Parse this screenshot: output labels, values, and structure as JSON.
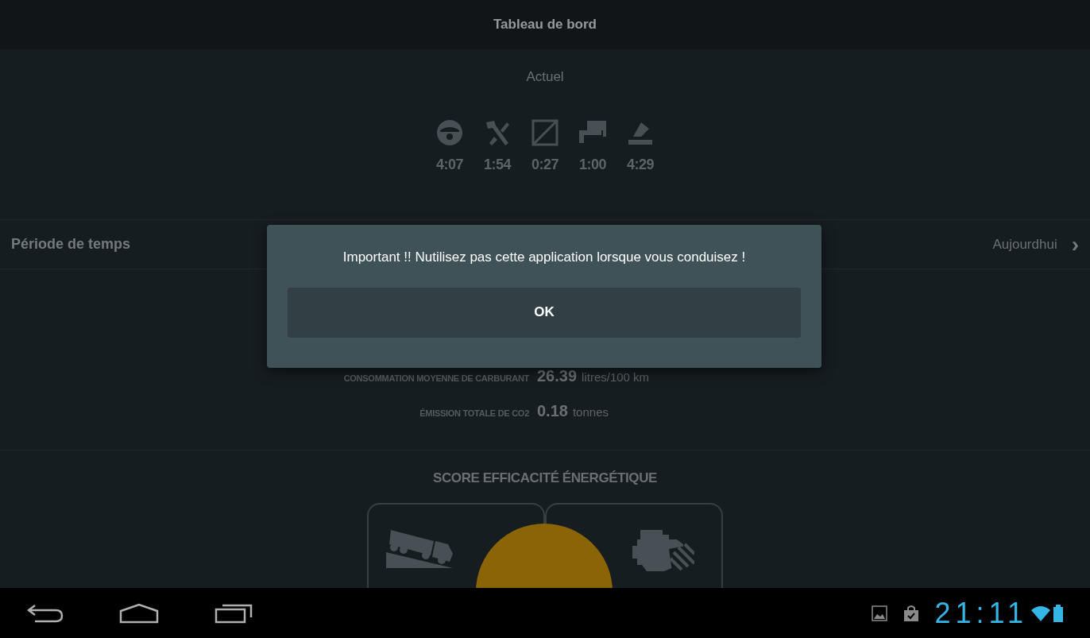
{
  "header": {
    "title": "Tableau de bord"
  },
  "current": {
    "title": "Actuel",
    "activities": [
      {
        "kind": "driving",
        "time": "4:07"
      },
      {
        "kind": "work",
        "time": "1:54"
      },
      {
        "kind": "availability",
        "time": "0:27"
      },
      {
        "kind": "rest",
        "time": "1:00"
      },
      {
        "kind": "other",
        "time": "4:29"
      }
    ]
  },
  "period": {
    "label": "Période de temps",
    "value": "Aujourdhui",
    "chevron": "›"
  },
  "stats": [
    {
      "label": "CONSOMMATION MOYENNE DE CARBURANT",
      "value": "26.39",
      "unit": "litres/100 km"
    },
    {
      "label": "ÉMISSION TOTALE DE CO2",
      "value": "0.18",
      "unit": "tonnes"
    }
  ],
  "score": {
    "title": "SCORE EFFICACITÉ ÉNERGÉTIQUE"
  },
  "dialog": {
    "message": "Important !! Nutilisez pas cette application lorsque vous conduisez !",
    "button": "OK"
  },
  "status_bar": {
    "time": "21:11"
  }
}
